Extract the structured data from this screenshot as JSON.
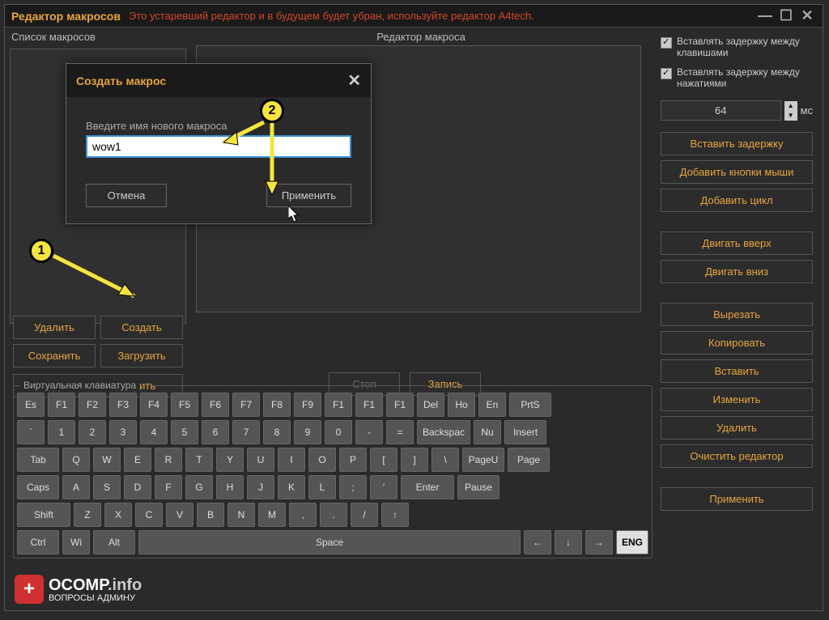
{
  "titlebar": {
    "title": "Редактор макросов",
    "warning": "Это устаревший редактор и в будущем будет убран, используйте редактор A4tech."
  },
  "panels": {
    "macro_list": "Список макросов",
    "macro_editor": "Редактор макроса"
  },
  "buttons": {
    "delete": "Удалить",
    "create": "Создать",
    "save": "Сохранить",
    "load": "Загрузить",
    "share": "Поделиться/Расшарить",
    "stop": "Стоп",
    "record": "Запись"
  },
  "right": {
    "chk_insert_delay_keys": "Вставлять задержку между клавишами",
    "chk_insert_delay_press": "Вставлять задержку между нажатиями",
    "delay_value": "64",
    "ms": "мс",
    "insert_delay": "Вставить задержку",
    "add_mouse": "Добавить кнопки мыши",
    "add_loop": "Добавить цикл",
    "move_up": "Двигать вверх",
    "move_down": "Двигать вниз",
    "cut": "Вырезать",
    "copy": "Копировать",
    "paste": "Вставить",
    "edit": "Изменить",
    "delete": "Удалить",
    "clear": "Очистить редактор",
    "apply": "Применить"
  },
  "keyboard": {
    "label": "Виртуальная клавиатура",
    "row1": [
      "Es",
      "F1",
      "F2",
      "F3",
      "F4",
      "F5",
      "F6",
      "F7",
      "F8",
      "F9",
      "F1",
      "F1",
      "F1",
      "Del",
      "Ho",
      "En",
      "PrtS"
    ],
    "row2": [
      "`",
      "1",
      "2",
      "3",
      "4",
      "5",
      "6",
      "7",
      "8",
      "9",
      "0",
      "-",
      "=",
      "Backspac",
      "Nu",
      "Insert"
    ],
    "row3": [
      "Tab",
      "Q",
      "W",
      "E",
      "R",
      "T",
      "Y",
      "U",
      "I",
      "O",
      "P",
      "[",
      "]",
      "\\",
      "PageU",
      "Page"
    ],
    "row4": [
      "Caps",
      "A",
      "S",
      "D",
      "F",
      "G",
      "H",
      "J",
      "K",
      "L",
      ";",
      "'",
      "Enter",
      "Pause"
    ],
    "row5": [
      "Shift",
      "Z",
      "X",
      "C",
      "V",
      "B",
      "N",
      "M",
      ",",
      ".",
      "/",
      "↑"
    ],
    "row6": [
      "Ctrl",
      "Wi",
      "Alt",
      "Space",
      "←",
      "↓",
      "→",
      "ENG"
    ]
  },
  "dialog": {
    "title": "Создать макрос",
    "label": "Введите имя нового макроса",
    "value": "wow1",
    "cancel": "Отмена",
    "ok": "Применить"
  },
  "annotations": {
    "badge1": "1",
    "badge2": "2"
  },
  "logo": {
    "main": "OCOMP",
    "suffix": ".info",
    "sub": "ВОПРОСЫ АДМИНУ"
  }
}
